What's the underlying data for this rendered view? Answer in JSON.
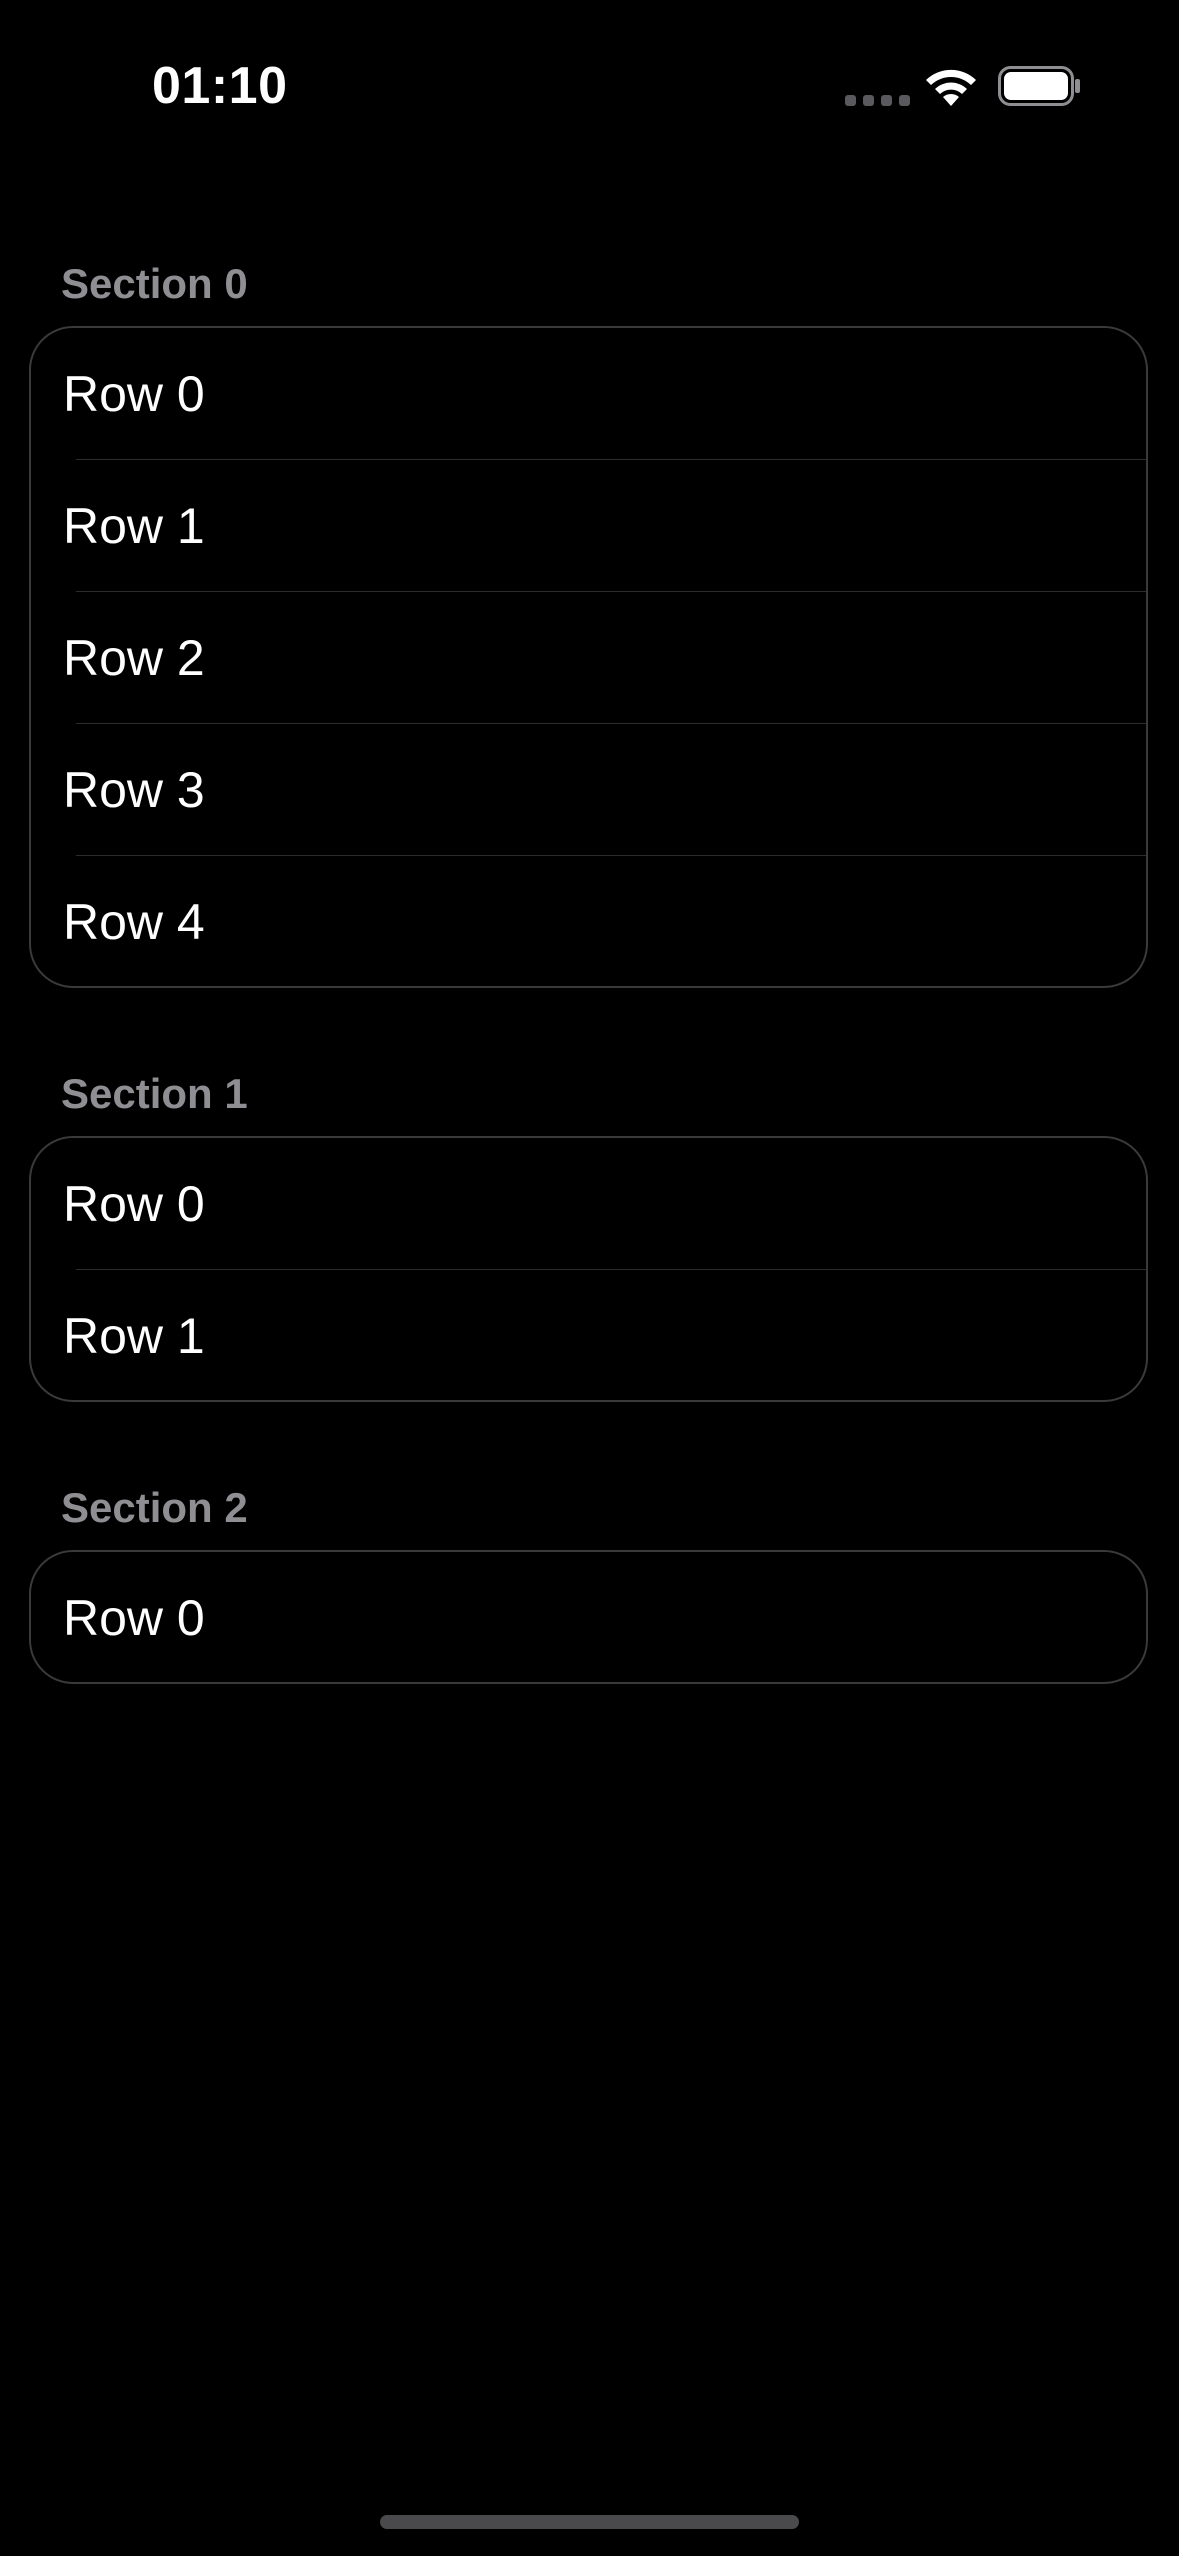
{
  "status_bar": {
    "time": "01:10"
  },
  "sections": [
    {
      "header": "Section 0",
      "rows": [
        "Row 0",
        "Row 1",
        "Row 2",
        "Row 3",
        "Row 4"
      ]
    },
    {
      "header": "Section 1",
      "rows": [
        "Row 0",
        "Row 1"
      ]
    },
    {
      "header": "Section 2",
      "rows": [
        "Row 0"
      ]
    }
  ],
  "colors": {
    "background": "#000000",
    "section_header": "#8e8e93",
    "card_border": "#3a3a3c",
    "divider": "#2c2c2e",
    "row_text": "#ffffff"
  },
  "icons": {
    "cellular": "cellular-signal-icon",
    "wifi": "wifi-icon",
    "battery": "battery-icon"
  }
}
